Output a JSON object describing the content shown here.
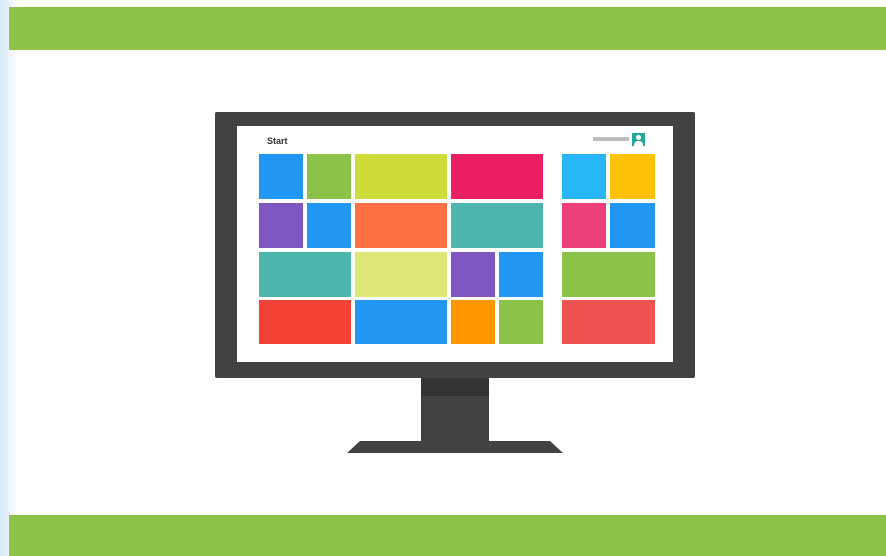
{
  "colors": {
    "band_green": "#8bc34a",
    "monitor_frame": "#424242",
    "neck_dark": "#333333",
    "screen_bg": "#ffffff",
    "avatar_bg": "#26a69a"
  },
  "screen": {
    "title": "Start",
    "user_icon": "user-avatar-icon"
  },
  "tiles": [
    {
      "color": "#2196f3"
    },
    {
      "color": "#8bc34a"
    },
    {
      "color": "#cddc39"
    },
    {
      "color": "#e91e63"
    },
    {
      "color": "#7e57c2"
    },
    {
      "color": "#2196f3"
    },
    {
      "color": "#ff7043"
    },
    {
      "color": "#4db6ac"
    },
    {
      "color": "#4db6ac"
    },
    {
      "color": "#dce775"
    },
    {
      "color": "#7e57c2"
    },
    {
      "color": "#2196f3"
    },
    {
      "color": "#f44336"
    },
    {
      "color": "#2196f3"
    },
    {
      "color": "#ff9800"
    },
    {
      "color": "#8bc34a"
    },
    {
      "color": "#29b6f6"
    },
    {
      "color": "#ffc107"
    },
    {
      "color": "#ec407a"
    },
    {
      "color": "#2196f3"
    },
    {
      "color": "#8bc34a"
    },
    {
      "color": "#ef5350"
    }
  ]
}
